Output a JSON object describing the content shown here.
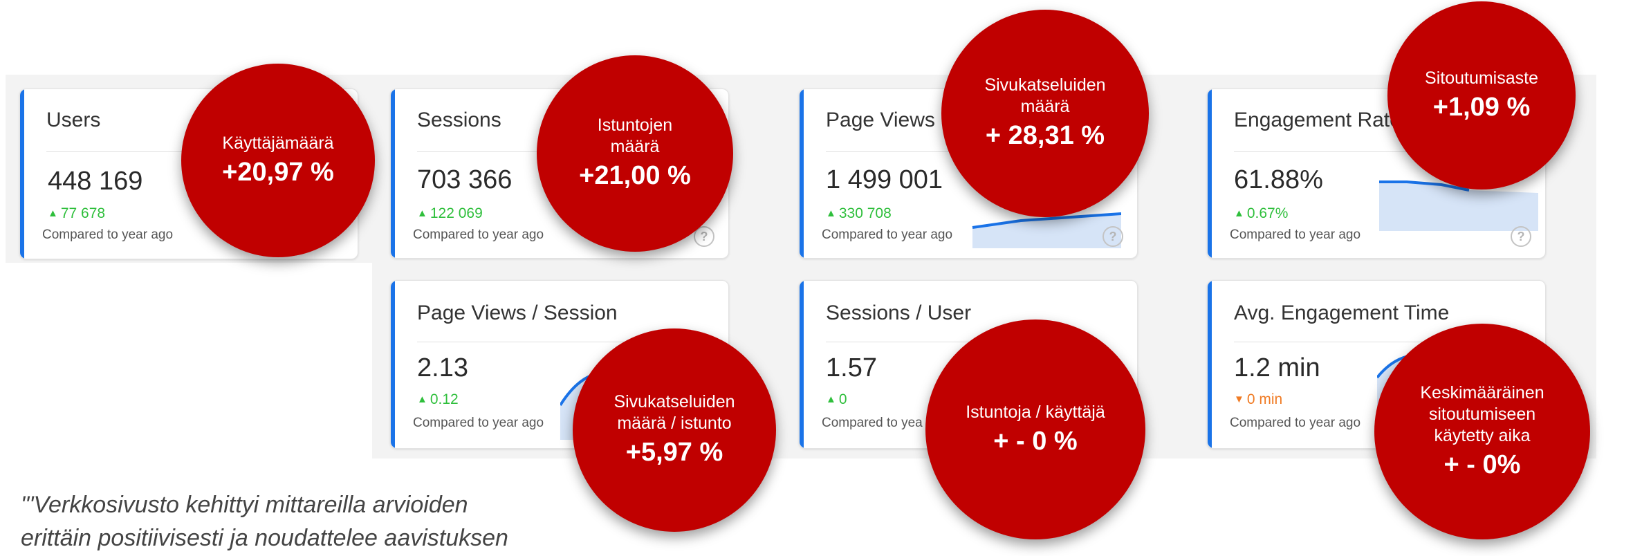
{
  "cards": {
    "users": {
      "title": "Users",
      "value": "448 169",
      "delta": "77 678",
      "compared": "Compared to year ago"
    },
    "sessions": {
      "title": "Sessions",
      "value": "703 366",
      "delta": "122 069",
      "compared": "Compared to year ago"
    },
    "page_views": {
      "title": "Page Views",
      "value": "1 499 001",
      "delta": "330 708",
      "compared": "Compared to year ago"
    },
    "engagement_rate": {
      "title": "Engagement Rate",
      "value": "61.88%",
      "delta": "0.67%",
      "compared": "Compared to year ago"
    },
    "page_views_session": {
      "title": "Page Views / Session",
      "value": "2.13",
      "delta": "0.12",
      "compared": "Compared to year ago"
    },
    "sessions_user": {
      "title": "Sessions / User",
      "value": "1.57",
      "delta": "0",
      "compared": "Compared to yea"
    },
    "avg_engagement_time": {
      "title": "Avg. Engagement Time",
      "value": "1.2 min",
      "delta": "0 min",
      "compared": "Compared to year ago"
    }
  },
  "help_label": "?",
  "bubbles": {
    "users": {
      "label": "Käyttäjämäärä",
      "pct": "+20,97 %"
    },
    "sessions": {
      "label": "Istuntojen määrä",
      "pct": "+21,00 %"
    },
    "page_views": {
      "label": "Sivukatseluiden määrä",
      "pct": "+ 28,31 %"
    },
    "engagement_rate": {
      "label": "Sitoutumisaste",
      "pct": "+1,09 %"
    },
    "page_views_session": {
      "label": "Sivukatseluiden määrä / istunto",
      "pct": "+5,97 %"
    },
    "sessions_user": {
      "label": "Istuntoja / käyttäjä",
      "pct": "+ - 0 %"
    },
    "avg_engagement_time": {
      "label": "Keskimääräinen sitoutumiseen käytetty aika",
      "pct": "+ - 0%"
    }
  },
  "quote": {
    "line1": "\"'Verkkosivusto kehittyi mittareilla arvioiden",
    "line2": "erittäin positiivisesti ja noudattelee aavistuksen"
  },
  "colors": {
    "accent": "#1a73e8",
    "bubble": "#c00000",
    "delta_up": "#2fbf3c",
    "delta_down": "#f07b24"
  },
  "icons": {
    "up": "▲",
    "down": "▼"
  }
}
